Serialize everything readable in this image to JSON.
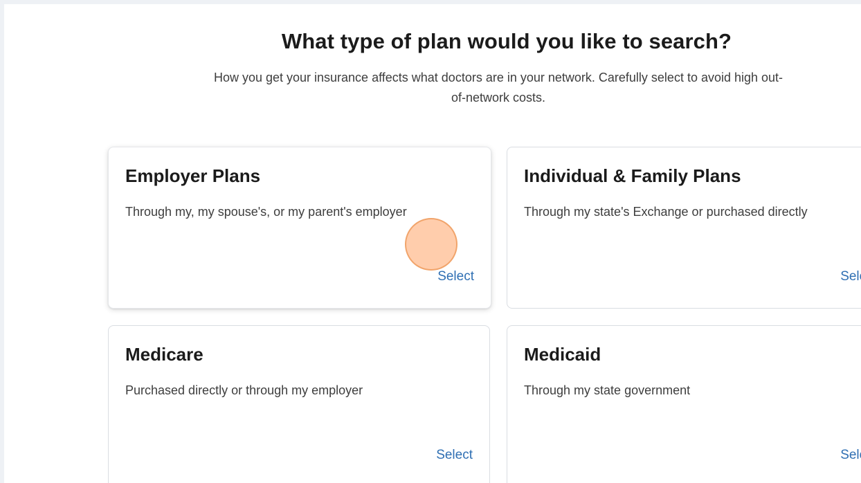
{
  "page": {
    "heading": "What type of plan would you like to search?",
    "subheading": "How you get your insurance affects what doctors are in your network. Carefully select to avoid high out-of-network costs."
  },
  "plans": [
    {
      "title": "Employer Plans",
      "description": "Through my, my spouse's, or my parent's employer",
      "select_label": "Select"
    },
    {
      "title": "Individual & Family Plans",
      "description": "Through my state's Exchange or purchased directly",
      "select_label": "Select"
    },
    {
      "title": "Medicare",
      "description": "Purchased directly or through my employer",
      "select_label": "Select"
    },
    {
      "title": "Medicaid",
      "description": "Through my state government",
      "select_label": "Select"
    }
  ],
  "colors": {
    "link": "#2f6fb3",
    "background": "#eef1f5",
    "cursor_highlight": "#ffba8c"
  }
}
